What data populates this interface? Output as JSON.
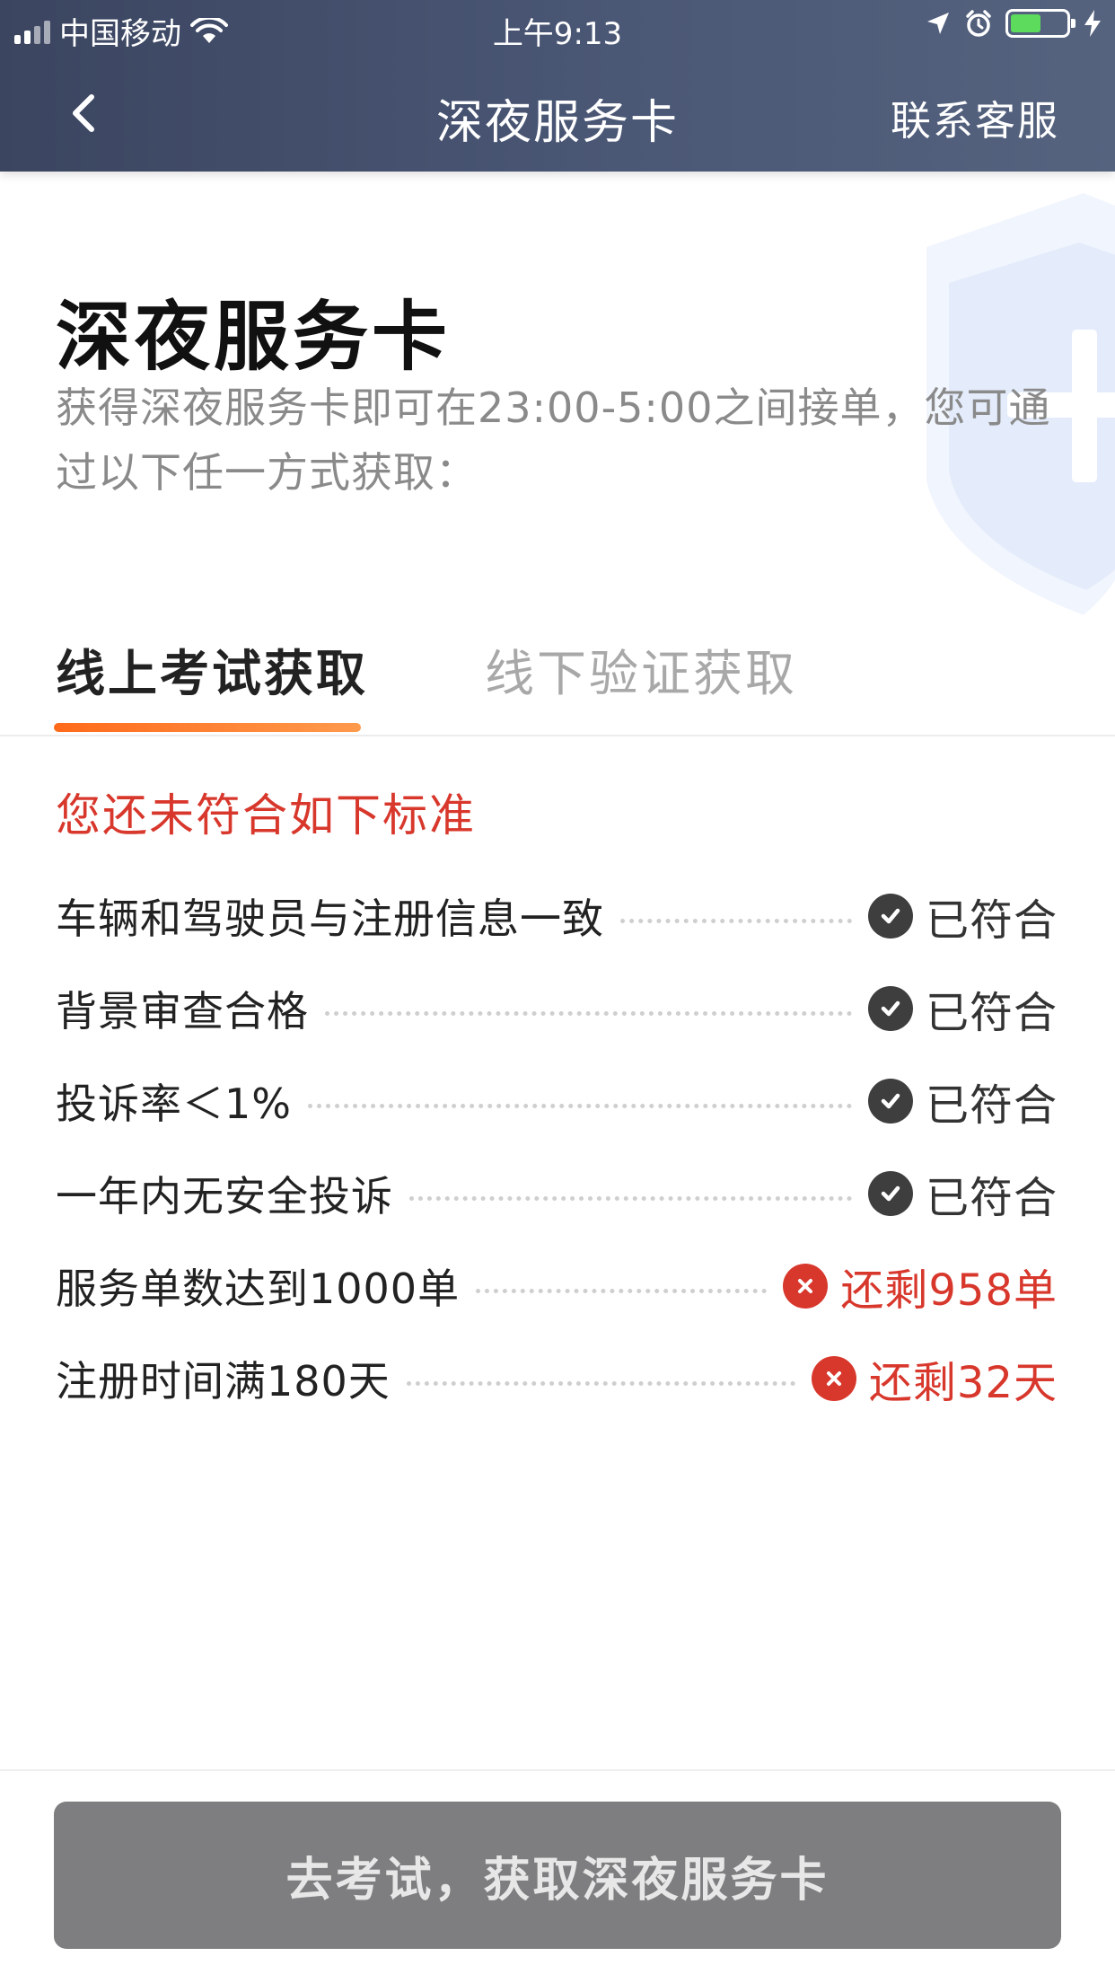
{
  "status_bar": {
    "carrier": "中国移动",
    "time": "上午9:13",
    "battery_level": 0.55
  },
  "nav": {
    "title": "深夜服务卡",
    "contact": "联系客服"
  },
  "hero": {
    "title": "深夜服务卡",
    "description": "获得深夜服务卡即可在23:00-5:00之间接单，您可通过以下任一方式获取："
  },
  "tabs": [
    {
      "label": "线上考试获取",
      "active": true
    },
    {
      "label": "线下验证获取",
      "active": false
    }
  ],
  "notice": "您还未符合如下标准",
  "criteria": [
    {
      "label": "车辆和驾驶员与注册信息一致",
      "status": "已符合",
      "met": true
    },
    {
      "label": "背景审查合格",
      "status": "已符合",
      "met": true
    },
    {
      "label": "投诉率＜1%",
      "status": "已符合",
      "met": true
    },
    {
      "label": "一年内无安全投诉",
      "status": "已符合",
      "met": true
    },
    {
      "label": "服务单数达到1000单",
      "status": "还剩958单",
      "met": false
    },
    {
      "label": "注册时间满180天",
      "status": "还剩32天",
      "met": false
    }
  ],
  "cta": {
    "label": "去考试，获取深夜服务卡"
  },
  "colors": {
    "nav_bg": "#4a5775",
    "accent": "#ff7a2a",
    "error": "#d8372c",
    "cta_bg": "#7e7e80"
  }
}
